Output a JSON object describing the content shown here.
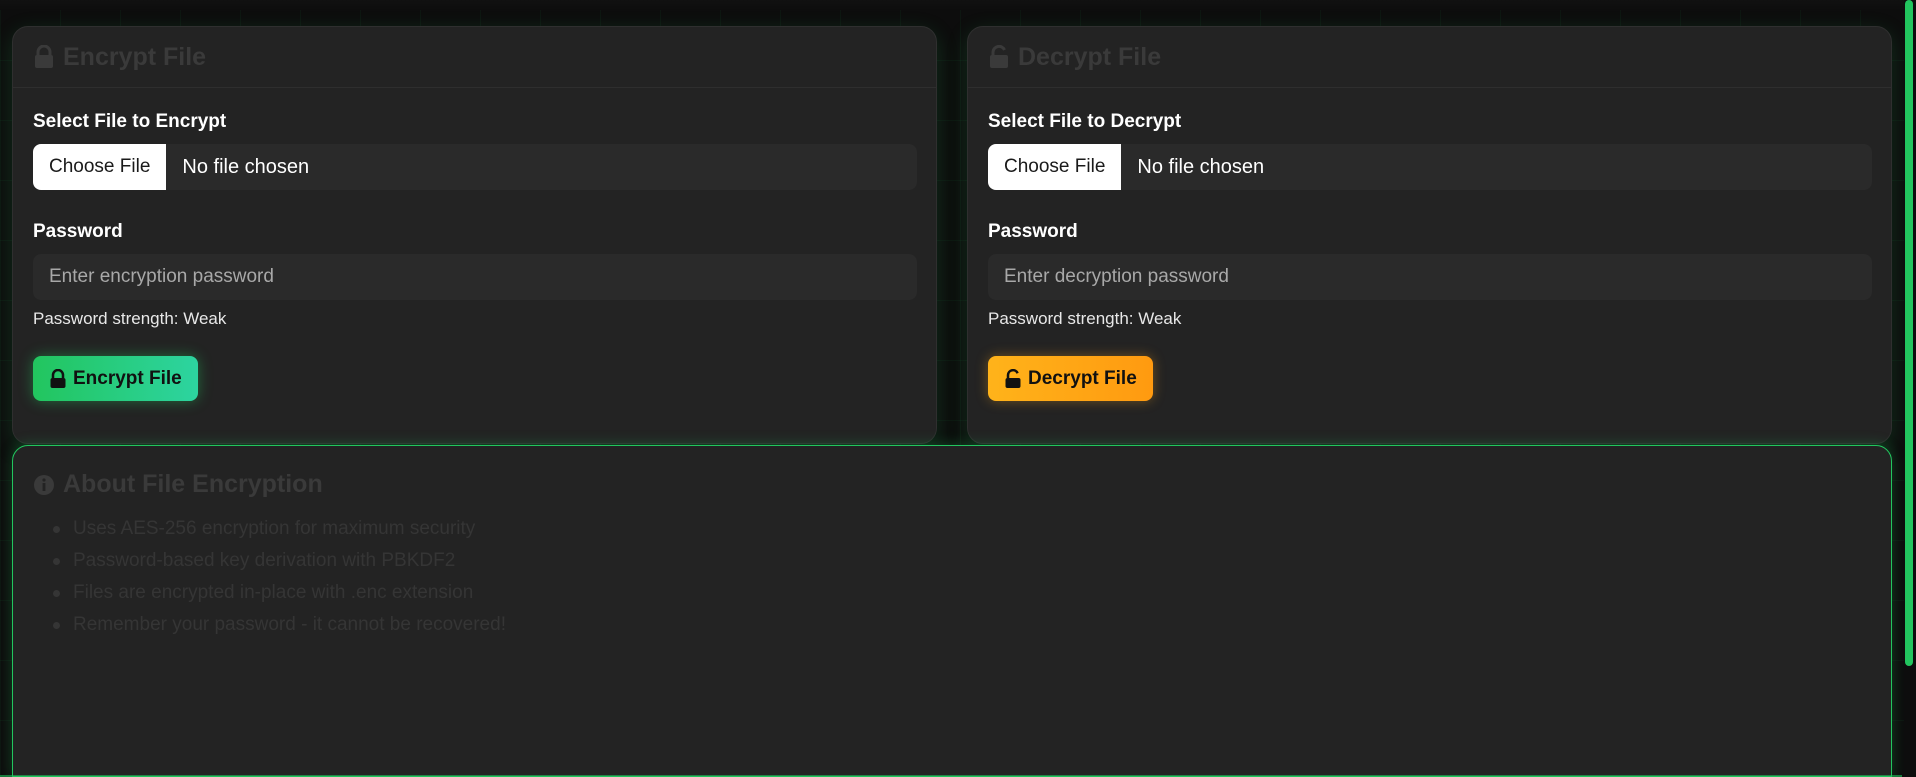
{
  "encrypt": {
    "title": "Encrypt File",
    "file_label": "Select File to Encrypt",
    "choose_button": "Choose File",
    "file_status": "No file chosen",
    "password_label": "Password",
    "password_placeholder": "Enter encryption password",
    "strength_text": "Password strength: Weak",
    "action_label": "Encrypt File",
    "action_color": "#22c55e"
  },
  "decrypt": {
    "title": "Decrypt File",
    "file_label": "Select File to Decrypt",
    "choose_button": "Choose File",
    "file_status": "No file chosen",
    "password_label": "Password",
    "password_placeholder": "Enter decryption password",
    "strength_text": "Password strength: Weak",
    "action_label": "Decrypt File",
    "action_color": "#ff9f10"
  },
  "about": {
    "title": "About File Encryption",
    "items": [
      "Uses AES-256 encryption for maximum security",
      "Password-based key derivation with PBKDF2",
      "Files are encrypted in-place with .enc extension",
      "Remember your password - it cannot be recovered!"
    ]
  },
  "icons": {
    "encrypt_header": "lock-icon",
    "decrypt_header": "unlock-icon",
    "about_header": "info-icon"
  },
  "theme": {
    "accent": "#22c55e",
    "background": "#0d0d0d",
    "card": "#232323"
  }
}
